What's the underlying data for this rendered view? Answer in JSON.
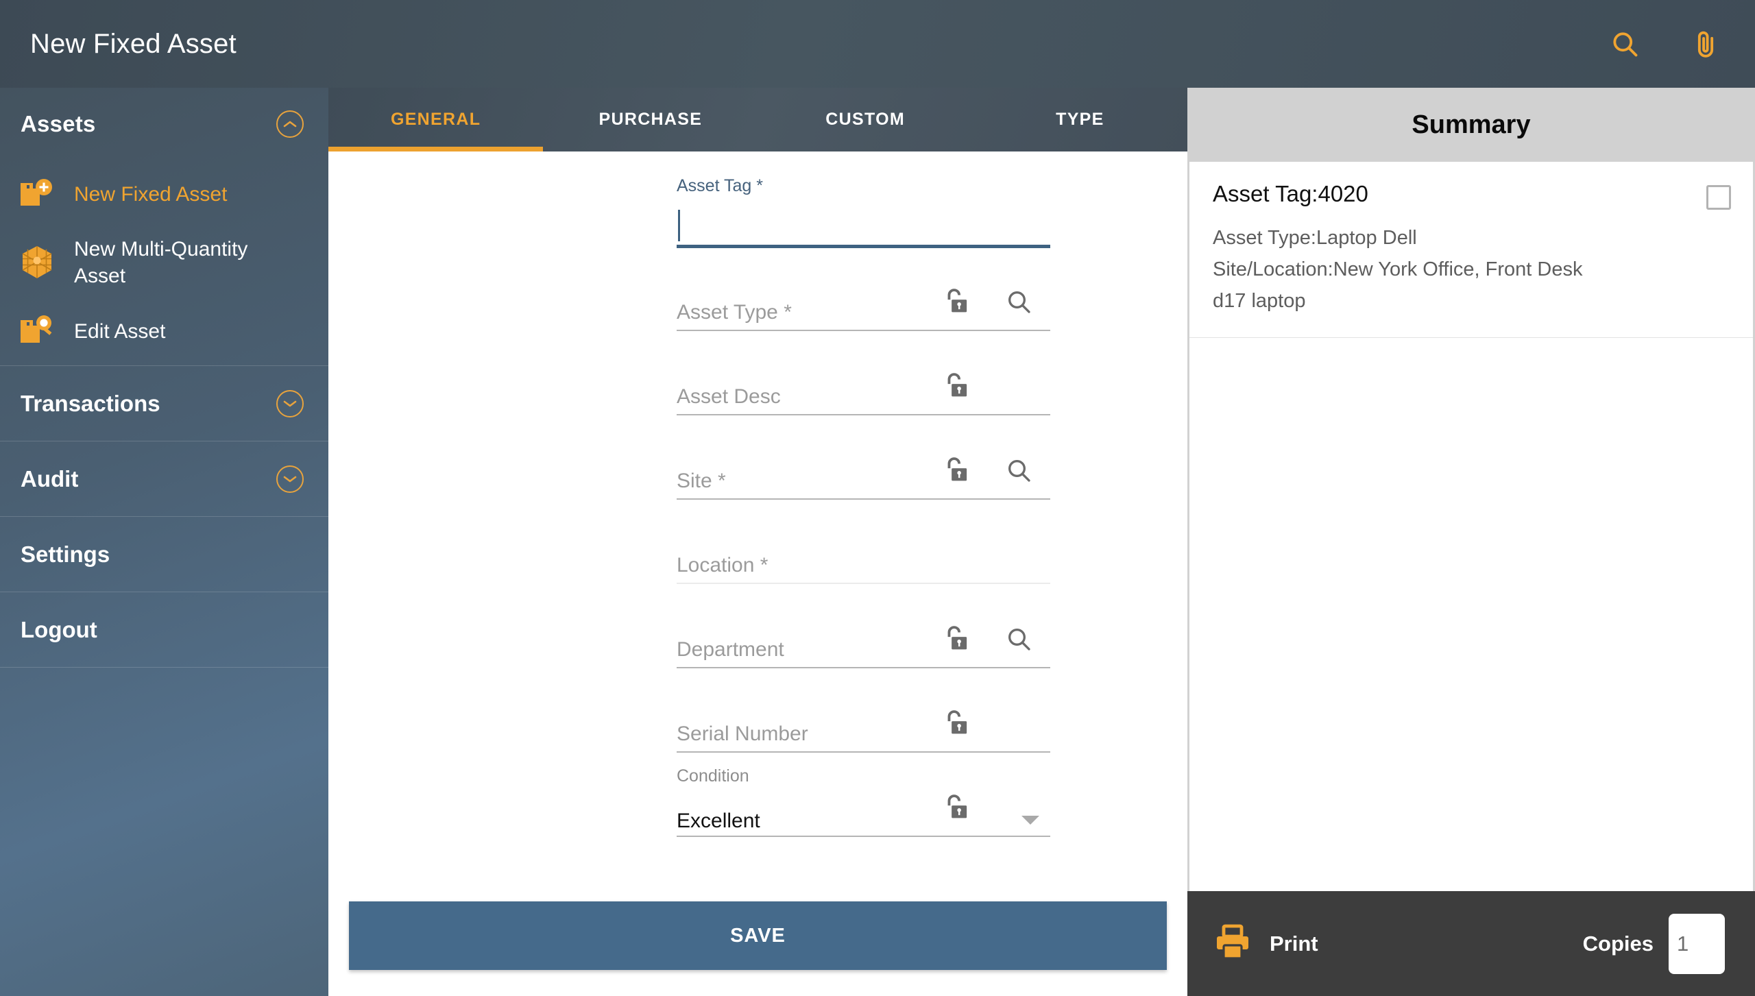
{
  "topbar": {
    "title": "New Fixed Asset",
    "search_icon": "search-icon",
    "attach_icon": "paperclip-icon"
  },
  "sidebar": {
    "assets": {
      "label": "Assets",
      "chevron": "chevron-up-icon",
      "items": [
        {
          "label": "New Fixed Asset",
          "icon": "box-add-icon",
          "active": true
        },
        {
          "label": "New Multi-Quantity Asset",
          "icon": "cube-icon",
          "active": false
        },
        {
          "label": "Edit Asset",
          "icon": "box-search-icon",
          "active": false
        }
      ]
    },
    "rows": [
      {
        "label": "Transactions",
        "chevron": "chevron-down-icon",
        "has_chevron": true
      },
      {
        "label": "Audit",
        "chevron": "chevron-down-icon",
        "has_chevron": true
      },
      {
        "label": "Settings",
        "has_chevron": false
      },
      {
        "label": "Logout",
        "has_chevron": false
      }
    ]
  },
  "tabs": [
    {
      "label": "GENERAL",
      "active": true
    },
    {
      "label": "PURCHASE",
      "active": false
    },
    {
      "label": "CUSTOM",
      "active": false
    },
    {
      "label": "TYPE",
      "active": false
    }
  ],
  "form": {
    "fields": [
      {
        "label": "Asset Tag *",
        "value": "",
        "placeholder": "",
        "focused": true,
        "lock": false,
        "search": false,
        "dropdown": false,
        "underline": "focus"
      },
      {
        "label": "Asset Type *",
        "value": "",
        "placeholder": "Asset Type *",
        "focused": false,
        "lock": true,
        "search": true,
        "dropdown": false,
        "underline": "normal"
      },
      {
        "label": "Asset Desc",
        "value": "",
        "placeholder": "Asset Desc",
        "focused": false,
        "lock": true,
        "search": false,
        "dropdown": false,
        "underline": "normal"
      },
      {
        "label": "Site *",
        "value": "",
        "placeholder": "Site *",
        "focused": false,
        "lock": true,
        "search": true,
        "dropdown": false,
        "underline": "normal"
      },
      {
        "label": "Location *",
        "value": "",
        "placeholder": "Location *",
        "focused": false,
        "lock": false,
        "search": false,
        "dropdown": false,
        "underline": "light"
      },
      {
        "label": "Department",
        "value": "",
        "placeholder": "Department",
        "focused": false,
        "lock": true,
        "search": true,
        "dropdown": false,
        "underline": "normal"
      },
      {
        "label": "Serial Number",
        "value": "",
        "placeholder": "Serial Number",
        "focused": false,
        "lock": true,
        "search": false,
        "dropdown": false,
        "underline": "normal"
      },
      {
        "label": "Condition",
        "value": "Excellent",
        "placeholder": "",
        "focused": false,
        "lock": true,
        "search": false,
        "dropdown": true,
        "underline": "normal"
      }
    ],
    "save_label": "SAVE"
  },
  "summary": {
    "title": "Summary",
    "card": {
      "asset_tag": "Asset Tag:4020",
      "lines": [
        "Asset Type:Laptop Dell",
        "Site/Location:New York Office, Front Desk",
        "d17 laptop"
      ],
      "checkbox_checked": false
    },
    "print_label": "Print",
    "print_icon": "printer-icon",
    "copies_label": "Copies",
    "copies_value": "1"
  },
  "colors": {
    "accent_orange": "#f0a430",
    "header_slate": "#434f5a",
    "save_blue": "#456a8b",
    "summary_gray": "#d1d1d1",
    "print_bar": "#3d3d3d"
  }
}
